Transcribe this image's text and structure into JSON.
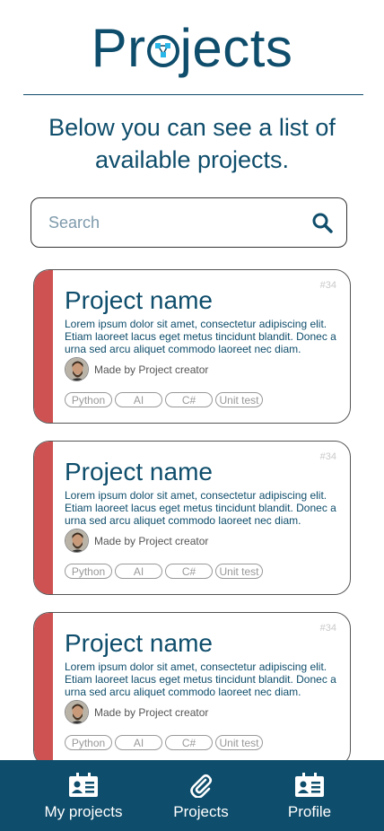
{
  "header": {
    "logo_prefix": "Pr",
    "logo_suffix": "jects"
  },
  "intro_text": "Below you can see a list of available projects.",
  "search": {
    "placeholder": "Search"
  },
  "projects": [
    {
      "id": "#34",
      "name": "Project name",
      "description": "Lorem ipsum dolor sit amet, consectetur adipiscing elit. Etiam laoreet lacus eget metus tincidunt blandit. Donec a urna sed arcu aliquet commodo laoreet nec diam.",
      "creator": "Made by Project creator",
      "tags": [
        "Python",
        "AI",
        "C#",
        "Unit test"
      ]
    },
    {
      "id": "#34",
      "name": "Project name",
      "description": "Lorem ipsum dolor sit amet, consectetur adipiscing elit. Etiam laoreet lacus eget metus tincidunt blandit. Donec a urna sed arcu aliquet commodo laoreet nec diam.",
      "creator": "Made by Project creator",
      "tags": [
        "Python",
        "AI",
        "C#",
        "Unit test"
      ]
    },
    {
      "id": "#34",
      "name": "Project name",
      "description": "Lorem ipsum dolor sit amet, consectetur adipiscing elit. Etiam laoreet lacus eget metus tincidunt blandit. Donec a urna sed arcu aliquet commodo laoreet nec diam.",
      "creator": "Made by Project creator",
      "tags": [
        "Python",
        "AI",
        "C#",
        "Unit test"
      ]
    }
  ],
  "nav": {
    "items": [
      {
        "label": "My projects",
        "icon": "id-card-icon"
      },
      {
        "label": "Projects",
        "icon": "paperclip-icon"
      },
      {
        "label": "Profile",
        "icon": "id-card-icon"
      }
    ]
  },
  "colors": {
    "primary": "#0e4d6b",
    "accent_stripe": "#cf5252",
    "logo_nodes": "#29b6e8"
  }
}
